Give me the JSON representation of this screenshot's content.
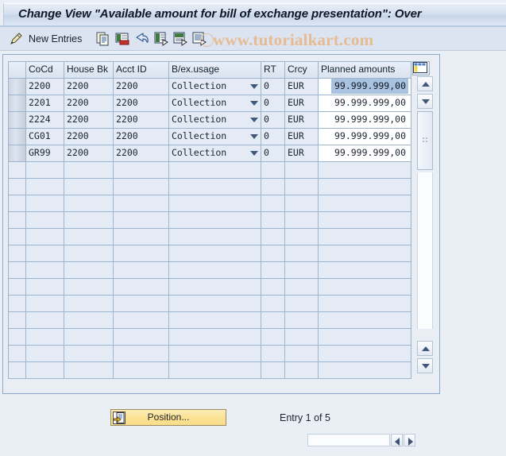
{
  "window": {
    "title": "Change View \"Available amount for bill of exchange presentation\": Over",
    "title_full": "Change View \"Available amount for bill of exchange presentation\": Overview"
  },
  "toolbar": {
    "items": [
      {
        "name": "display-change-icon",
        "icon": "pencil-toggle-icon",
        "label": ""
      },
      {
        "name": "new-entries-button",
        "icon": "",
        "label": "New Entries"
      },
      {
        "name": "copy-as-icon",
        "icon": "copy-icon",
        "label": ""
      },
      {
        "name": "delete-icon",
        "icon": "delete-row-icon",
        "label": ""
      },
      {
        "name": "undo-icon",
        "icon": "undo-arrow-icon",
        "label": ""
      },
      {
        "name": "select-all-icon",
        "icon": "select-all-icon",
        "label": ""
      },
      {
        "name": "deselect-all-icon",
        "icon": "deselect-all-icon",
        "label": ""
      },
      {
        "name": "select-block-icon",
        "icon": "select-block-icon",
        "label": ""
      }
    ]
  },
  "watermark": {
    "text": "www.tutorialkart.com"
  },
  "table": {
    "config_icon": "table-settings-icon",
    "columns": [
      {
        "key": "cocd",
        "label": "CoCd"
      },
      {
        "key": "house",
        "label": "House Bk"
      },
      {
        "key": "acct",
        "label": "Acct ID"
      },
      {
        "key": "usage",
        "label": "B/ex.usage"
      },
      {
        "key": "rt",
        "label": "RT"
      },
      {
        "key": "crcy",
        "label": "Crcy"
      },
      {
        "key": "amt",
        "label": "Planned amounts"
      }
    ],
    "rows": [
      {
        "cocd": "2200",
        "house": "2200",
        "acct": "2200",
        "usage": "Collection",
        "rt": "0",
        "crcy": "EUR",
        "amt": "99.999.999,00",
        "selected": true
      },
      {
        "cocd": "2201",
        "house": "2200",
        "acct": "2200",
        "usage": "Collection",
        "rt": "0",
        "crcy": "EUR",
        "amt": "99.999.999,00",
        "selected": false
      },
      {
        "cocd": "2224",
        "house": "2200",
        "acct": "2200",
        "usage": "Collection",
        "rt": "0",
        "crcy": "EUR",
        "amt": "99.999.999,00",
        "selected": false
      },
      {
        "cocd": "CG01",
        "house": "2200",
        "acct": "2200",
        "usage": "Collection",
        "rt": "0",
        "crcy": "EUR",
        "amt": "99.999.999,00",
        "selected": false
      },
      {
        "cocd": "GR99",
        "house": "2200",
        "acct": "2200",
        "usage": "Collection",
        "rt": "0",
        "crcy": "EUR",
        "amt": "99.999.999,00",
        "selected": false
      }
    ],
    "empty_row_count": 13
  },
  "footer": {
    "position_button_label": "Position...",
    "entry_status": "Entry 1 of 5"
  }
}
